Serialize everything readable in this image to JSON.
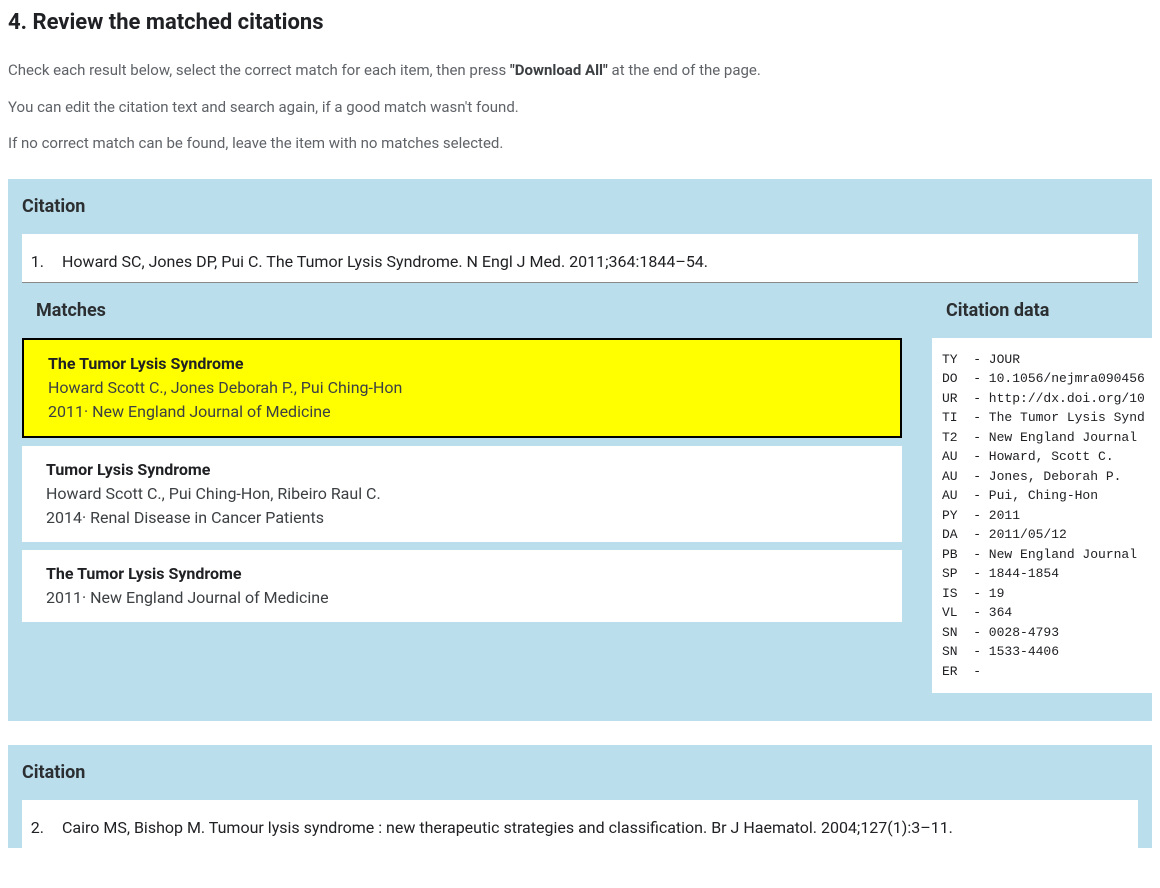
{
  "heading": "4. Review the matched citations",
  "intro": {
    "line1_pre": "Check each result below, select the correct match for each item, then press ",
    "line1_bold": "\"Download All\"",
    "line1_post": " at the end of the page.",
    "line2": "You can edit the citation text and search again, if a good match wasn't found.",
    "line3": "If no correct match can be found, leave the item with no matches selected."
  },
  "labels": {
    "citation": "Citation",
    "matches": "Matches",
    "citation_data": "Citation data"
  },
  "citations": [
    {
      "number": "1.",
      "text": "Howard SC, Jones DP, Pui C. The Tumor Lysis Syndrome. N Engl J Med. 2011;364:1844–54.",
      "matches": [
        {
          "selected": true,
          "title": "The Tumor Lysis Syndrome",
          "authors": "Howard Scott C., Jones Deborah P., Pui Ching-Hon",
          "meta": "2011· New England Journal of Medicine"
        },
        {
          "selected": false,
          "title": "Tumor Lysis Syndrome",
          "authors": "Howard Scott C., Pui Ching-Hon, Ribeiro Raul C.",
          "meta": "2014· Renal Disease in Cancer Patients"
        },
        {
          "selected": false,
          "title": "The Tumor Lysis Syndrome",
          "authors": "",
          "meta": "2011· New England Journal of Medicine"
        }
      ],
      "ris": "TY  - JOUR\nDO  - 10.1056/nejmra090456\nUR  - http://dx.doi.org/10\nTI  - The Tumor Lysis Synd\nT2  - New England Journal \nAU  - Howard, Scott C.\nAU  - Jones, Deborah P.\nAU  - Pui, Ching-Hon\nPY  - 2011\nDA  - 2011/05/12\nPB  - New England Journal \nSP  - 1844-1854\nIS  - 19\nVL  - 364\nSN  - 0028-4793\nSN  - 1533-4406\nER  -"
    },
    {
      "number": "2.",
      "text": "Cairo MS, Bishop M. Tumour lysis syndrome : new therapeutic strategies and classification. Br J Haematol. 2004;127(1):3–11."
    }
  ]
}
